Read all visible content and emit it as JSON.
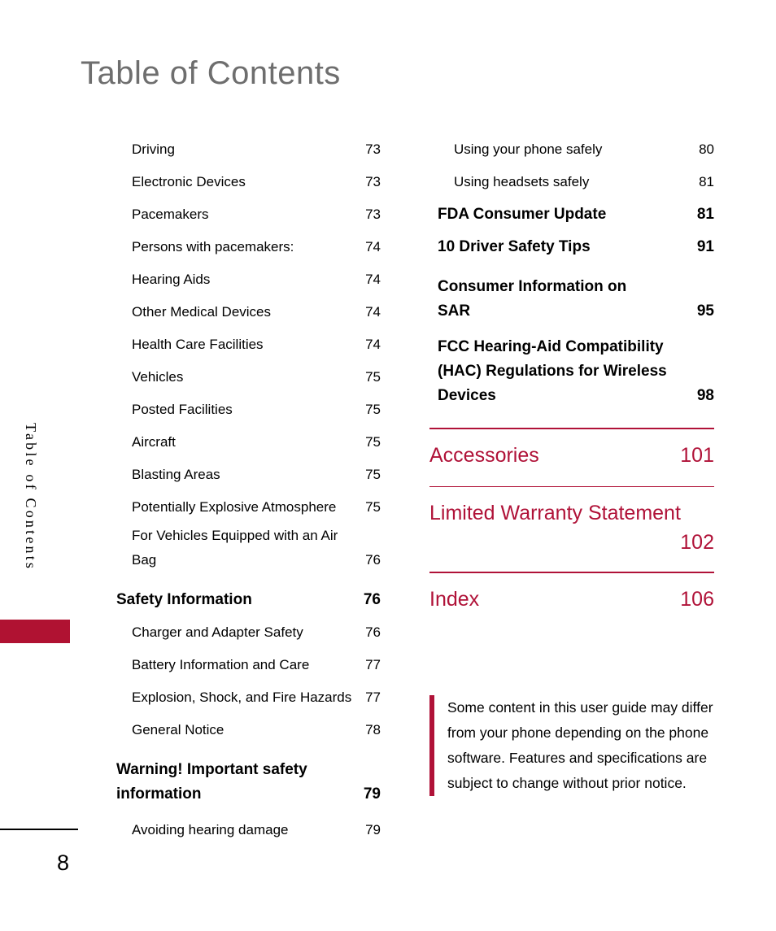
{
  "page": {
    "title": "Table of Contents",
    "folio": "8",
    "side_tab_label": "Table of Contents",
    "title_color": "#6e6e6e",
    "accent_color": "#b01238",
    "tab_color": "#b01232"
  },
  "columns": {
    "left": [
      {
        "level": 2,
        "title": "Driving",
        "page": "73"
      },
      {
        "level": 2,
        "title": "Electronic Devices",
        "page": "73"
      },
      {
        "level": 2,
        "title": "Pacemakers",
        "page": "73"
      },
      {
        "level": 2,
        "title": "Persons with pacemakers:",
        "page": "74"
      },
      {
        "level": 2,
        "title": "Hearing Aids",
        "page": "74"
      },
      {
        "level": 2,
        "title": "Other Medical Devices",
        "page": "74"
      },
      {
        "level": 2,
        "title": "Health Care Facilities",
        "page": "74"
      },
      {
        "level": 2,
        "title": "Vehicles",
        "page": "75"
      },
      {
        "level": 2,
        "title": "Posted Facilities",
        "page": "75"
      },
      {
        "level": 2,
        "title": "Aircraft",
        "page": "75"
      },
      {
        "level": 2,
        "title": "Blasting Areas",
        "page": "75"
      },
      {
        "level": 2,
        "title": "Potentially Explosive Atmosphere",
        "page": "75"
      },
      {
        "level": 2,
        "wrapped": true,
        "line1": "For Vehicles Equipped with an Air",
        "line2": "Bag",
        "title": "For Vehicles Equipped with an Air Bag",
        "page": "76"
      },
      {
        "level": 1,
        "title": "Safety Information",
        "page": "76"
      },
      {
        "level": 2,
        "title": "Charger and Adapter Safety",
        "page": "76"
      },
      {
        "level": 2,
        "title": "Battery Information and Care",
        "page": "77"
      },
      {
        "level": 2,
        "joined": true,
        "title": "Explosion, Shock, and Fire Hazards",
        "page": "77"
      },
      {
        "level": 2,
        "title": "General Notice",
        "page": "78"
      },
      {
        "level": 1,
        "wrapped": true,
        "line1": "Warning! Important safety",
        "line2": "information",
        "title": "Warning! Important safety information",
        "page": "79"
      },
      {
        "level": 2,
        "title": "Avoiding hearing damage",
        "page": "79"
      }
    ],
    "right": [
      {
        "level": 2,
        "title": "Using your phone safely",
        "page": "80"
      },
      {
        "level": 2,
        "title": "Using headsets safely",
        "page": "81"
      },
      {
        "level": 1,
        "title": "FDA Consumer Update",
        "page": "81"
      },
      {
        "level": 1,
        "title": "10 Driver Safety Tips",
        "page": "91"
      },
      {
        "level": 1,
        "wrapped": true,
        "line1": "Consumer Information on",
        "line2": "SAR",
        "title": "Consumer Information on SAR",
        "page": "95"
      },
      {
        "level": 1,
        "wrapped": true,
        "line1": "FCC Hearing-Aid Compatibility",
        "line2": "(HAC) Regulations for Wireless",
        "line3": "Devices",
        "title": "FCC Hearing-Aid Compatibility (HAC) Regulations for Wireless Devices",
        "page": "98"
      }
    ],
    "parts": [
      {
        "title": "Accessories",
        "page": "101"
      },
      {
        "title": "Limited Warranty Statement",
        "page": "102",
        "wrapped": true
      },
      {
        "title": "Index",
        "page": "106"
      }
    ]
  },
  "note": {
    "text": "Some content in this user guide may differ from your phone depending on the phone software. Features and specifications are subject to change without prior notice."
  }
}
